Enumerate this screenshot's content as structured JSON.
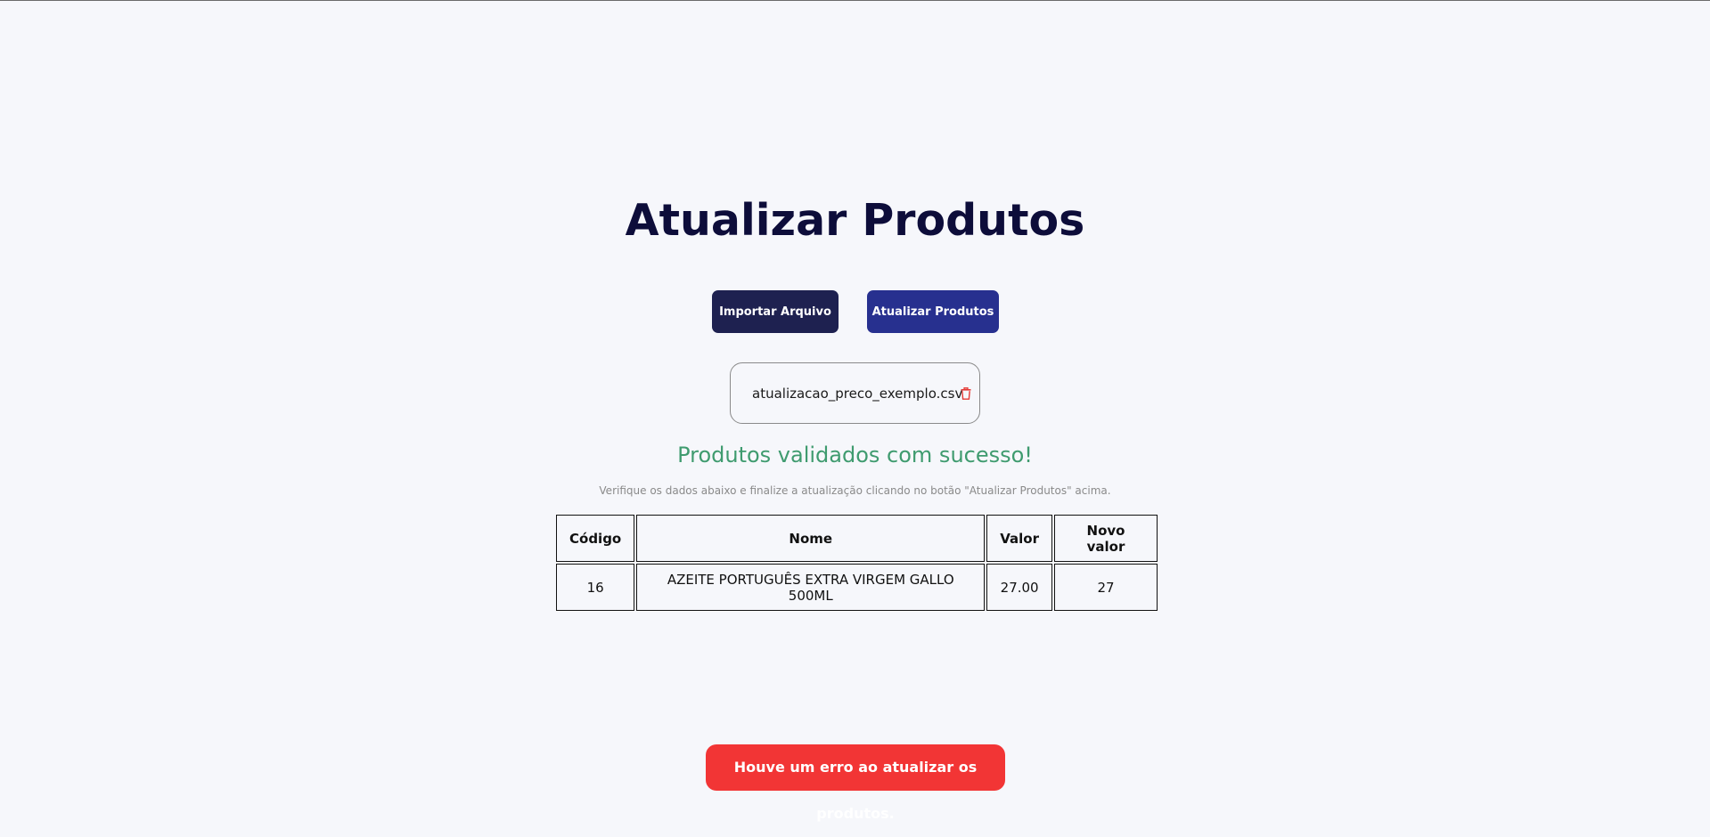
{
  "page": {
    "title": "Atualizar Produtos"
  },
  "actions": {
    "import_label": "Importar Arquivo",
    "update_label": "Atualizar Produtos"
  },
  "file": {
    "name": "atualizacao_preco_exemplo.csv",
    "remove_icon": "trash-icon"
  },
  "status": {
    "success_message": "Produtos validados com sucesso!",
    "hint": "Verifique os dados abaixo e finalize a atualização clicando no botão \"Atualizar Produtos\" acima.",
    "error_message": "Houve um erro ao atualizar os produtos."
  },
  "table": {
    "headers": [
      "Código",
      "Nome",
      "Valor",
      "Novo valor"
    ],
    "rows": [
      [
        "16",
        "AZEITE PORTUGUÊS EXTRA VIRGEM GALLO 500ML",
        "27.00",
        "27"
      ]
    ]
  },
  "colors": {
    "background": "#f6f7fb",
    "title": "#0d0d3a",
    "import_button": "#1e2150",
    "update_button": "#27308f",
    "success": "#3f9b6f",
    "error": "#f23535",
    "trash": "#e53935"
  }
}
